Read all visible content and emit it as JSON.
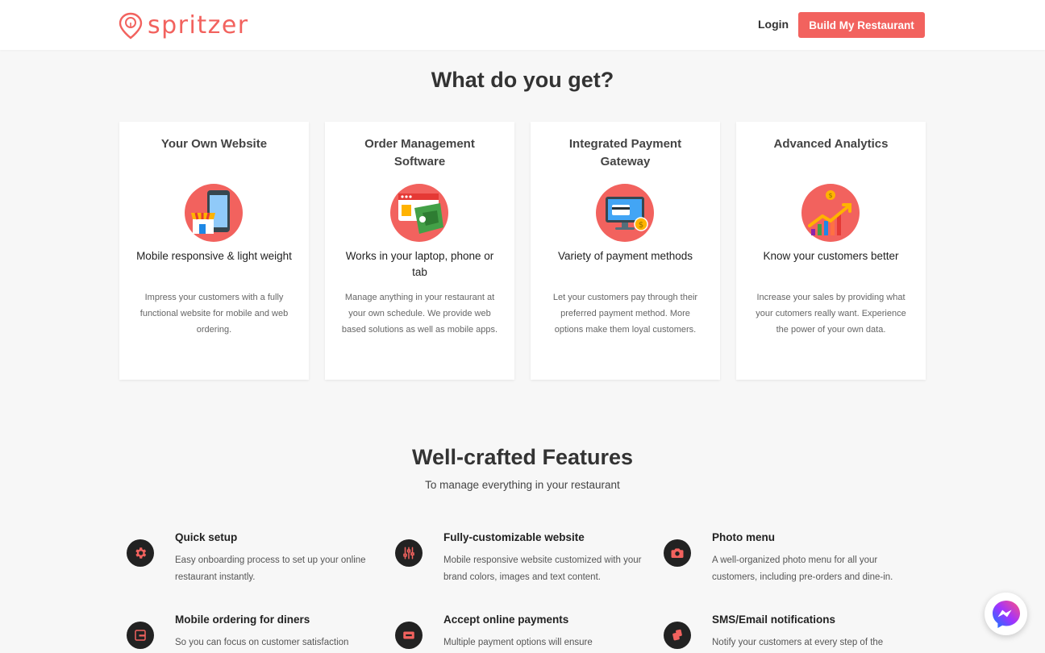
{
  "header": {
    "logo_text": "spritzer",
    "login_label": "Login",
    "cta_label": "Build My Restaurant"
  },
  "what_section": {
    "title": "What do you get?",
    "cards": [
      {
        "title": "Your Own Website",
        "icon": "mobile-storefront-icon",
        "subtitle": "Mobile responsive & light weight",
        "description": "Impress your customers with a fully functional website for mobile and web ordering."
      },
      {
        "title": "Order Management Software",
        "icon": "order-management-icon",
        "subtitle": "Works in your laptop, phone or tab",
        "description": "Manage anything in your restaurant at your own schedule. We provide web based solutions as well as mobile apps."
      },
      {
        "title": "Integrated Payment Gateway",
        "icon": "payment-gateway-icon",
        "subtitle": "Variety of payment methods",
        "description": "Let your customers pay through their preferred payment method. More options make them loyal customers."
      },
      {
        "title": "Advanced Analytics",
        "icon": "analytics-growth-icon",
        "subtitle": "Know your customers better",
        "description": "Increase your sales by providing what your cutomers really want. Experience the power of your own data."
      }
    ]
  },
  "features_section": {
    "title": "Well-crafted Features",
    "subtitle": "To manage everything in your restaurant",
    "items": [
      {
        "title": "Quick setup",
        "icon": "gear-icon",
        "description": "Easy onboarding process to set up your online restaurant instantly."
      },
      {
        "title": "Fully-customizable website",
        "icon": "sliders-icon",
        "description": "Mobile responsive website customized with your brand colors, images and text content."
      },
      {
        "title": "Photo menu",
        "icon": "camera-icon",
        "description": "A well-organized photo menu for all your customers, including pre-orders and dine-in."
      },
      {
        "title": "Mobile ordering for diners",
        "icon": "tablet-icon",
        "description": "So you can focus on customer satisfaction"
      },
      {
        "title": "Accept online payments",
        "icon": "credit-card-icon",
        "description": "Multiple payment options will ensure"
      },
      {
        "title": "SMS/Email notifications",
        "icon": "notification-icon",
        "description": "Notify your customers at every step of the"
      }
    ]
  },
  "colors": {
    "accent": "#f2625e",
    "background": "#f7f7f7",
    "text": "#333333",
    "icon_dark": "#222222"
  },
  "chat_widget": {
    "icon": "messenger-icon"
  }
}
